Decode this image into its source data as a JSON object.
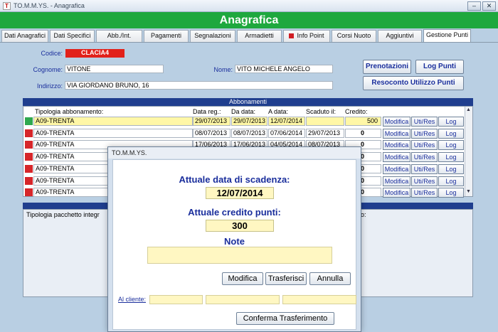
{
  "window": {
    "title": "TO.M.M.YS. - Anagrafica",
    "app_icon_glyph": "T",
    "minimize_glyph": "–",
    "close_glyph": "✕"
  },
  "header": {
    "title": "Anagrafica",
    "color": "#1ea83e"
  },
  "tabs": [
    {
      "label": "Dati Anagrafici"
    },
    {
      "label": "Dati Specifici"
    },
    {
      "label": "Abb./Int."
    },
    {
      "label": "Pagamenti"
    },
    {
      "label": "Segnalazioni"
    },
    {
      "label": "Armadietti"
    },
    {
      "label": "Info Point"
    },
    {
      "label": "Corsi Nuoto"
    },
    {
      "label": "Aggiuntivi"
    },
    {
      "label": "Gestione Punti"
    }
  ],
  "active_tab": "Gestione Punti",
  "form": {
    "codice_label": "Codice:",
    "codice_value": "CLACIA4",
    "cognome_label": "Cognome:",
    "cognome_value": "VITONE",
    "nome_label": "Nome:",
    "nome_value": "VITO MICHELE ANGELO",
    "indirizzo_label": "Indirizzo:",
    "indirizzo_value": "VIA GIORDANO BRUNO, 16"
  },
  "buttons": {
    "prenotazioni": "Prenotazioni",
    "log_punti": "Log Punti",
    "resoconto": "Resoconto Utilizzo Punti"
  },
  "abbonamenti": {
    "section_title": "Abbonamenti",
    "columns": [
      "Tipologia abbonamento:",
      "Data reg.:",
      "Da data:",
      "A data:",
      "Scaduto il:",
      "Credito:"
    ],
    "row_buttons": {
      "modifica": "Modifica",
      "utires": "Uti/Res",
      "log": "Log"
    },
    "rows": [
      {
        "status": "#2fa84f",
        "tipo": "A09-TRENTA",
        "data_reg": "29/07/2013",
        "da": "29/07/2013",
        "a": "12/07/2014",
        "scaduto": "",
        "credito": "500",
        "selected": true
      },
      {
        "status": "#d6262a",
        "tipo": "A09-TRENTA",
        "data_reg": "08/07/2013",
        "da": "08/07/2013",
        "a": "07/06/2014",
        "scaduto": "29/07/2013",
        "credito": "0",
        "selected": false
      },
      {
        "status": "#d6262a",
        "tipo": "A09-TRENTA",
        "data_reg": "17/06/2013",
        "da": "17/06/2013",
        "a": "04/05/2014",
        "scaduto": "08/07/2013",
        "credito": "0",
        "selected": false
      },
      {
        "status": "#d6262a",
        "tipo": "A09-TRENTA",
        "data_reg": "",
        "da": "",
        "a": "",
        "scaduto": "",
        "credito": "0",
        "selected": false
      },
      {
        "status": "#d6262a",
        "tipo": "A09-TRENTA",
        "data_reg": "",
        "da": "",
        "a": "",
        "scaduto": "",
        "credito": "0",
        "selected": false
      },
      {
        "status": "#d6262a",
        "tipo": "A09-TRENTA",
        "data_reg": "",
        "da": "",
        "a": "",
        "scaduto": "",
        "credito": "0",
        "selected": false
      },
      {
        "status": "#d6262a",
        "tipo": "A09-TRENTA",
        "data_reg": "",
        "da": "",
        "a": "",
        "scaduto": "",
        "credito": "0",
        "selected": false
      }
    ]
  },
  "pacchetti": {
    "column_left": "Tipologia pacchetto integr",
    "column_right": "o:"
  },
  "dialog": {
    "title": "TO.M.M.YS.",
    "scadenza_label": "Attuale data di scadenza:",
    "scadenza_value": "12/07/2014",
    "credito_label": "Attuale credito punti:",
    "credito_value": "300",
    "note_label": "Note",
    "modifica": "Modifica",
    "trasferisci": "Trasferisci",
    "annulla": "Annulla",
    "cliente_label": "Al cliente:",
    "conferma": "Conferma Trasferimento"
  },
  "icons": {
    "scroll_up": "▲",
    "scroll_down": "▼"
  }
}
